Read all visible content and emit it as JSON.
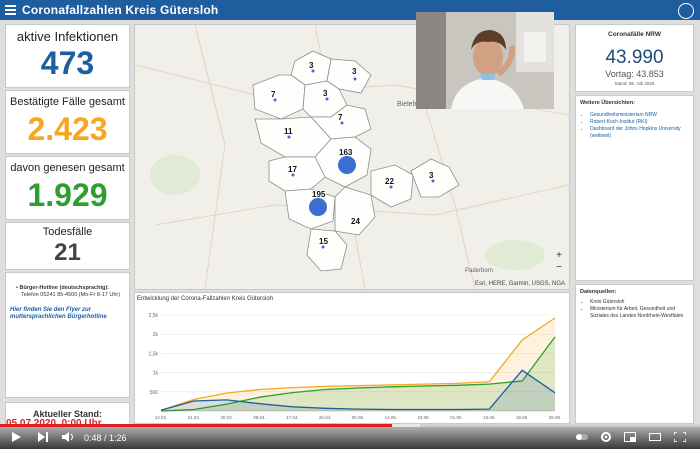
{
  "header": {
    "title": "Coronafallzahlen Kreis Gütersloh"
  },
  "metrics": [
    {
      "label": "aktive Infektionen",
      "value": "473",
      "color": "#1f5e9e"
    },
    {
      "label": "Bestätigte Fälle gesamt",
      "value": "2.423",
      "color": "#f5a623"
    },
    {
      "label": "davon genesen gesamt",
      "value": "1.929",
      "color": "#2e9e2e"
    },
    {
      "label": "Todesfälle",
      "value": "21",
      "color": "#444444"
    }
  ],
  "hotline": {
    "title": "Bürger-Hotline (deutschsprachig):",
    "phone": "Telefon 05241 85-4500 (Mo-Fr 8-17 Uhr)",
    "flyer_text": "Hier finden Sie den Flyer zur muttersprachlichen Bürgerhotline"
  },
  "status": {
    "label": "Aktueller Stand:",
    "date": "05.07.2020, 0:00 Uhr"
  },
  "map": {
    "attribution": "Esri, HERE, Garmin, USGS, NGA",
    "zoom_in": "+",
    "zoom_out": "−",
    "place_labels": [
      "Bielefeld",
      "Paderborn"
    ],
    "region_values": [
      "3",
      "3",
      "7",
      "3",
      "7",
      "11",
      "163",
      "17",
      "22",
      "3",
      "195",
      "24",
      "15"
    ]
  },
  "chart": {
    "title": "Entwicklung der Corona-Fallzahlen Kreis Gütersloh"
  },
  "chart_data": {
    "type": "area",
    "title": "Entwicklung der Corona-Fallzahlen Kreis Gütersloh",
    "x": [
      "12.03.",
      "21.03.",
      "30.03.",
      "08.04.",
      "17.04.",
      "26.04.",
      "05.05.",
      "14.05.",
      "23.05.",
      "01.06.",
      "10.06.",
      "19.06.",
      "28.06."
    ],
    "y_ticks": [
      "500",
      "1k",
      "1,5k",
      "2k",
      "2,5k"
    ],
    "ylim": [
      0,
      2500
    ],
    "series": [
      {
        "name": "Bestätigte Fälle gesamt",
        "color": "#f5a623",
        "values": [
          20,
          300,
          470,
          560,
          610,
          640,
          660,
          680,
          700,
          720,
          760,
          1850,
          2423
        ]
      },
      {
        "name": "davon genesen gesamt",
        "color": "#2e9e2e",
        "values": [
          0,
          40,
          180,
          360,
          480,
          560,
          600,
          630,
          650,
          670,
          700,
          780,
          1929
        ]
      },
      {
        "name": "aktive Infektionen",
        "color": "#1f5e9e",
        "values": [
          20,
          260,
          290,
          190,
          110,
          70,
          50,
          40,
          40,
          40,
          50,
          1060,
          473
        ]
      }
    ]
  },
  "nrw": {
    "title": "Coronafälle NRW",
    "value": "43.990",
    "previous": "Vortag: 43.853",
    "date": "Stand: 05. Juli 2020"
  },
  "links": {
    "title": "Weitere Übersichten:",
    "items": [
      "Gesundheitsministerium NRW",
      "Robert-Koch-Institut (RKI)",
      "Dashboard der Johns Hopkins University (weltweit)"
    ]
  },
  "sources": {
    "title": "Datenquellen:",
    "items": [
      "Kreis Gütersloh",
      "Ministerium für Arbeit, Gesundheit und Soziales des Landes Nordrhein-Westfalen"
    ]
  },
  "player": {
    "time": "0:48 / 1:26",
    "progress": 0.56
  }
}
